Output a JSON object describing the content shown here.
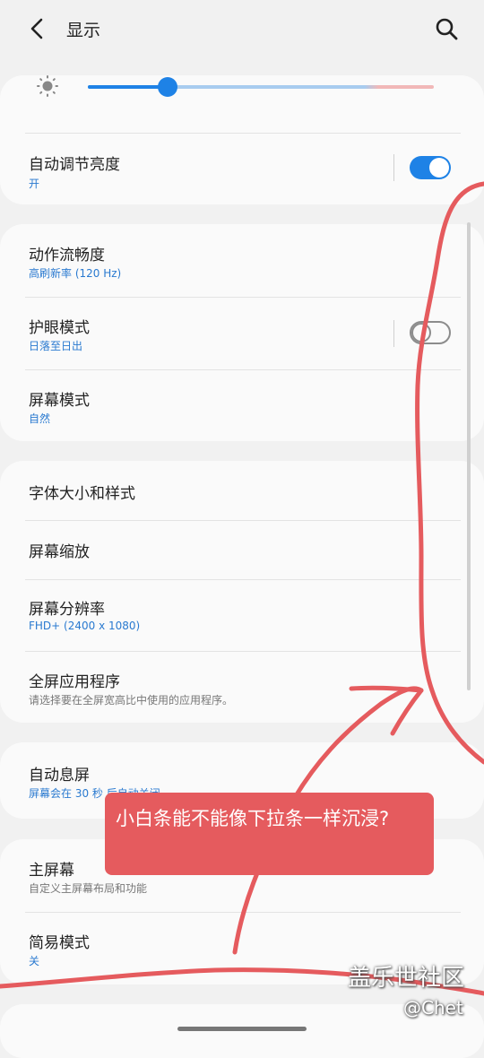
{
  "header": {
    "title": "显示"
  },
  "brightness": {
    "value_fraction": 0.23,
    "auto": {
      "title": "自动调节亮度",
      "value": "开",
      "enabled": true
    }
  },
  "group2": {
    "items": [
      {
        "title": "动作流畅度",
        "value": "高刷新率 (120 Hz)"
      },
      {
        "title": "护眼模式",
        "value": "日落至日出",
        "toggle": false
      },
      {
        "title": "屏幕模式",
        "value": "自然"
      }
    ]
  },
  "group3": {
    "items": [
      {
        "title": "字体大小和样式"
      },
      {
        "title": "屏幕缩放"
      },
      {
        "title": "屏幕分辨率",
        "value": "FHD+ (2400 x 1080)"
      },
      {
        "title": "全屏应用程序",
        "value": "请选择要在全屏宽高比中使用的应用程序。"
      }
    ]
  },
  "group4": {
    "title": "自动息屏",
    "value": "屏幕会在 30 秒 后自动关闭"
  },
  "group5": {
    "items": [
      {
        "title": "主屏幕",
        "value": "自定义主屏幕布局和功能"
      },
      {
        "title": "简易模式",
        "value": "关"
      }
    ]
  },
  "annotation": {
    "text": "小白条能不能像下拉条一样沉浸?"
  },
  "watermark": {
    "site": "盖乐世社区",
    "user": "@Chet"
  },
  "icons": {
    "back": "back-arrow-icon",
    "search": "search-icon",
    "brightness": "sun-icon"
  },
  "colors": {
    "accent": "#1e82e6",
    "background": "#f1f1f1",
    "card": "#fafafa",
    "annotation": "#e55b5e"
  }
}
